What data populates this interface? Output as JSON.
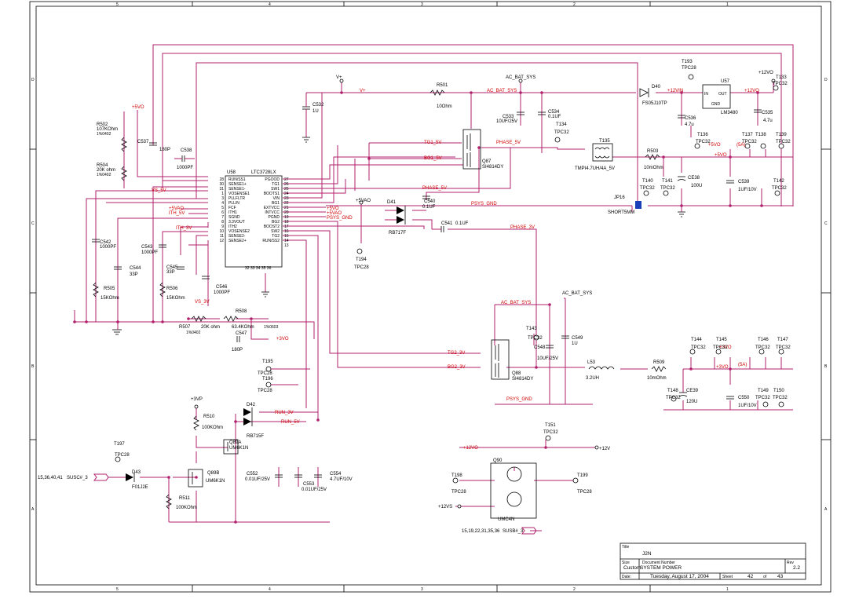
{
  "border": {
    "cols": [
      "5",
      "4",
      "3",
      "2",
      "1"
    ],
    "rows": [
      "D",
      "C",
      "B",
      "A"
    ]
  },
  "nets": {
    "vplus": "V+",
    "ac_bat_sys": "AC_BAT_SYS",
    "plus5vo": "+5VO",
    "plus5vao": "+5VAO",
    "plus12vo": "+12VO",
    "plus12vin": "+12VIN",
    "plus12v": "+12V",
    "plus12vs": "+12VS",
    "plus3vp": "+3VP",
    "plus3vo": "+3VO",
    "vs_5v": "VS_5V",
    "vs_3v": "VS_3V",
    "ith_5v": "ITH_5V",
    "ith_3v": "ITH_3V",
    "tg1_5v": "TG1_5V",
    "bg1_5v": "BG1_5V",
    "phase_5v": "PHASE_5V",
    "phase_3v": "PHASE_3V",
    "tg2_3v": "TG2_3V",
    "bg2_3v": "BG2_3V",
    "psys_gnd": "PSYS_GND",
    "run_3v": "RUN_3V",
    "run_5v": "RUN_5V",
    "susc": "SUSC#_3",
    "susb": "SUSB#_3",
    "susc_refs": "15,36,40,41",
    "susb_refs": "15,19,22,31,35,36",
    "5a_left": "(5A)",
    "5a_right": "(5A)"
  },
  "u58": {
    "ref": "U58",
    "part": "LTC3728LX",
    "left_pins": [
      {
        "num": "28",
        "name": "RUN/SS1"
      },
      {
        "num": "30",
        "name": "SENSE1+"
      },
      {
        "num": "31",
        "name": "SENSE1-"
      },
      {
        "num": "1",
        "name": "VOSENSE1"
      },
      {
        "num": "3",
        "name": "PLLFLTR"
      },
      {
        "num": "4",
        "name": "PLLIN"
      },
      {
        "num": "5",
        "name": "FCF"
      },
      {
        "num": "6",
        "name": "ITH1"
      },
      {
        "num": "7",
        "name": "SGND"
      },
      {
        "num": "8",
        "name": "3.3VOUT"
      },
      {
        "num": "9",
        "name": "ITH2"
      },
      {
        "num": "10",
        "name": "VOSENSE2"
      },
      {
        "num": "11",
        "name": "SENSE2-"
      },
      {
        "num": "12",
        "name": "SENSE2+"
      }
    ],
    "right_pins": [
      {
        "num": "27",
        "name": "PGOOD"
      },
      {
        "num": "26",
        "name": "TG1"
      },
      {
        "num": "25",
        "name": "SW1"
      },
      {
        "num": "24",
        "name": "BOOTS1"
      },
      {
        "num": "23",
        "name": "VIN"
      },
      {
        "num": "22",
        "name": "BG1"
      },
      {
        "num": "21",
        "name": "EXTVCC"
      },
      {
        "num": "20",
        "name": "INTVCC"
      },
      {
        "num": "19",
        "name": "PGND"
      },
      {
        "num": "18",
        "name": "BG2"
      },
      {
        "num": "17",
        "name": "BOOST2"
      },
      {
        "num": "16",
        "name": "SW2"
      },
      {
        "num": "15",
        "name": "TG2"
      },
      {
        "num": "14",
        "name": "RUN/SS2"
      },
      {
        "num": "13",
        "name": ""
      }
    ],
    "bottom_pins": "32 33 34 35 36"
  },
  "u57": {
    "ref": "U57",
    "part": "LM3480",
    "in": "IN",
    "out": "OUT",
    "gnd": "GND"
  },
  "components": {
    "r502": {
      "ref": "R502",
      "val": "107KOhm",
      "tol": "1%0402"
    },
    "r504": {
      "ref": "R504",
      "val": "20K ohm",
      "tol": "1%0402"
    },
    "c537": {
      "ref": "C537",
      "val": "180P"
    },
    "c538": {
      "ref": "C538",
      "val": "1000PF"
    },
    "c532": {
      "ref": "C532",
      "val": "1U"
    },
    "r501": {
      "ref": "R501",
      "val": "10Ohm"
    },
    "c533": {
      "ref": "C533",
      "val": "10UF/25V"
    },
    "c534": {
      "ref": "C534",
      "val": "0.1UF"
    },
    "d40": {
      "ref": "D40",
      "val": "FS05J10TP"
    },
    "c536": {
      "ref": "C536",
      "val": "4.7u"
    },
    "c535": {
      "ref": "C535",
      "val": "4.7u"
    },
    "q87": {
      "ref": "Q87",
      "val": "SI4814DY"
    },
    "t135": {
      "ref": "T135",
      "val": "TMPI4.7UH/4A_5V"
    },
    "r503": {
      "ref": "R503",
      "val": "10mOhm"
    },
    "ce38": {
      "ref": "CE38",
      "val": "100U"
    },
    "c539": {
      "ref": "C539",
      "val": "1UF/10V"
    },
    "jp16": {
      "ref": "JP16",
      "val": "SHORT5MM"
    },
    "d41": {
      "ref": "D41",
      "val": "RB717F"
    },
    "c540": {
      "ref": "C540",
      "val": "0.1UF"
    },
    "c541": {
      "ref": "C541",
      "val": "0.1UF"
    },
    "c542": {
      "ref": "C542",
      "val": "1000PF"
    },
    "c543": {
      "ref": "C543",
      "val": "1000PF"
    },
    "c544": {
      "ref": "C544",
      "val": "33P"
    },
    "c545": {
      "ref": "C545",
      "val": "33P"
    },
    "c546": {
      "ref": "C546",
      "val": "1000PF"
    },
    "r505": {
      "ref": "R505",
      "val": "15KOhm"
    },
    "r506": {
      "ref": "R506",
      "val": "15KOhm"
    },
    "r507": {
      "ref": "R507",
      "val": "20K ohm",
      "tol": "1%0402"
    },
    "r508": {
      "ref": "R508",
      "val": "63.4KOhm",
      "tol": "1%0603"
    },
    "c547": {
      "ref": "C547",
      "val": "180P"
    },
    "q88": {
      "ref": "Q88",
      "val": "SI4814DY"
    },
    "c548": {
      "ref": "C548",
      "val": "10UF/25V"
    },
    "c549": {
      "ref": "C549",
      "val": "1U"
    },
    "l53": {
      "ref": "L53",
      "val": "3.2UH"
    },
    "r509": {
      "ref": "R509",
      "val": "10mOhm"
    },
    "ce39": {
      "ref": "CE39",
      "val": "120U"
    },
    "c550": {
      "ref": "C550",
      "val": "1UF/10V"
    },
    "r510": {
      "ref": "R510",
      "val": "100KOhm"
    },
    "d42": {
      "ref": "D42",
      "val": "RB715F"
    },
    "q89a": {
      "ref": "Q89A",
      "val": "UM6K1N"
    },
    "q89b": {
      "ref": "Q89B",
      "val": "UM6K1N"
    },
    "d43": {
      "ref": "D43",
      "val": "F01J2E"
    },
    "r511": {
      "ref": "R511",
      "val": "100KOhm"
    },
    "c552": {
      "ref": "C552",
      "val": "0.01UF/25V"
    },
    "c553": {
      "ref": "C553",
      "val": "0.01UF/25V"
    },
    "c554": {
      "ref": "C554",
      "val": "4.7UF/10V"
    },
    "q90": {
      "ref": "Q90",
      "val": "UMC4N"
    }
  },
  "testpoints": {
    "t193": {
      "ref": "T193",
      "val": "TPC28"
    },
    "t133": {
      "ref": "T133",
      "val": "TPC32"
    },
    "t134": {
      "ref": "T134",
      "val": "TPC32"
    },
    "t136": {
      "ref": "T136",
      "val": "TPC32"
    },
    "t137": {
      "ref": "T137",
      "val": "TPC32"
    },
    "t138": {
      "ref": "T138",
      "val": ""
    },
    "t139": {
      "ref": "T139",
      "val": "TPC32"
    },
    "t140": {
      "ref": "T140",
      "val": "TPC32"
    },
    "t141": {
      "ref": "T141",
      "val": "TPC32"
    },
    "t142": {
      "ref": "T142",
      "val": "TPC32"
    },
    "t194": {
      "ref": "T194",
      "val": "TPC28"
    },
    "t143": {
      "ref": "T143",
      "val": "TPC32"
    },
    "t144": {
      "ref": "T144",
      "val": "TPC32"
    },
    "t145": {
      "ref": "T145",
      "val": "TPC32"
    },
    "t146": {
      "ref": "T146",
      "val": "TPC32"
    },
    "t147": {
      "ref": "T147",
      "val": "TPC32"
    },
    "t148": {
      "ref": "T148",
      "val": "TPC32"
    },
    "t149": {
      "ref": "T149",
      "val": "TPC32"
    },
    "t150": {
      "ref": "T150",
      "val": "TPC32"
    },
    "t195": {
      "ref": "T195",
      "val": "TPC28"
    },
    "t196": {
      "ref": "T196",
      "val": "TPC28"
    },
    "t197": {
      "ref": "T197",
      "val": "TPC28"
    },
    "t151": {
      "ref": "T151",
      "val": "TPC32"
    },
    "t198": {
      "ref": "T198",
      "val": "TPC28"
    },
    "t199": {
      "ref": "T199",
      "val": "TPC28"
    }
  },
  "title_block": {
    "title_label": "Title",
    "title": "J2N",
    "size_label": "Size",
    "size": "Custom",
    "docnum_label": "Document Number",
    "docnum": "SYSTEM POWER",
    "rev_label": "Rev",
    "rev": "2.2",
    "date_label": "Date:",
    "date": "Tuesday, August 17, 2004",
    "sheet_label": "Sheet",
    "sheet": "42",
    "of_label": "of",
    "total": "43"
  }
}
